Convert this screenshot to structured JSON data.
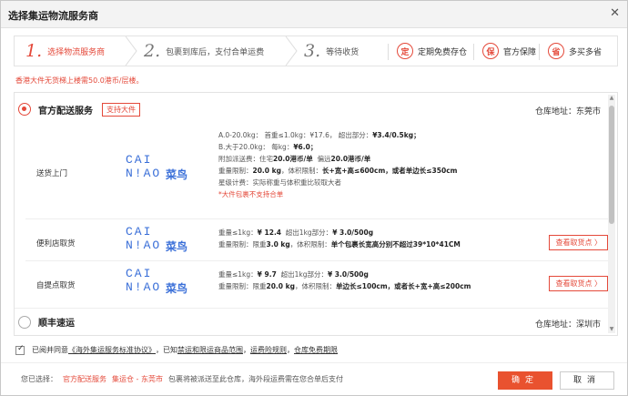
{
  "dialog": {
    "title": "选择集运物流服务商",
    "close_icon": "close-icon"
  },
  "steps": [
    {
      "num": "1.",
      "label": "选择物流服务商"
    },
    {
      "num": "2.",
      "label": "包裹到库后，支付合单运费"
    },
    {
      "num": "3.",
      "label": "等待收货"
    }
  ],
  "features": [
    {
      "icon_char": "定",
      "label": "定期免费存仓"
    },
    {
      "icon_char": "保",
      "label": "官方保障"
    },
    {
      "icon_char": "省",
      "label": "多买多省"
    }
  ],
  "notice": "香港大件无货梯上楼需50.0港币/层楼。",
  "providers": [
    {
      "name": "官方配送服务",
      "tag": "支持大件",
      "warehouse": "仓库地址：东莞市",
      "methods": [
        {
          "name": "送货上门",
          "logo_cai": "CAI",
          "logo_niao": "N!AO",
          "logo_cn": "菜鸟",
          "lines": [
            "A.0-20.0kg：         首重≤1.0kg：¥17.6， 超出部分：",
            "B.大于20.0kg：       每kg：",
            "附加派送费：住宅",
            "重量限制：",
            "星级计费：实际称重与体积重比较取大者",
            "*大件包裹不支持合单"
          ],
          "a_price": "¥3.4/0.5kg；",
          "b_price": "¥6.0；",
          "extra_res": "20.0港币/单",
          "extra_remote_label": "偏远",
          "extra_remote": "20.0港币/单",
          "weight_limit": "20.0 kg",
          "vol_label": "，体积限制：",
          "vol_limit": "长+宽+高≤600cm，或者单边长≤350cm"
        },
        {
          "name": "便利店取货",
          "logo_cai": "CAI",
          "logo_niao": "N!AO",
          "logo_cn": "菜鸟",
          "line1_pre": "重量≤1kg：",
          "line1_price": "¥ 12.4",
          "line1_mid": "超出1kg部分：",
          "line1_extra": "¥ 3.0/500g",
          "line2_pre": "重量限制：限重",
          "line2_weight": "3.0 kg",
          "line2_mid": "，体积限制：",
          "line2_vol": "单个包裹长宽高分别不超过39*10*41CM",
          "button": "查看取货点 〉"
        },
        {
          "name": "自提点取货",
          "logo_cai": "CAI",
          "logo_niao": "N!AO",
          "logo_cn": "菜鸟",
          "line1_pre": "重量≤1kg：",
          "line1_price": "¥ 9.7",
          "line1_mid": "超出1kg部分：",
          "line1_extra": "¥ 3.0/500g",
          "line2_pre": "重量限制：限重",
          "line2_weight": "20.0 kg",
          "line2_mid": "，体积限制：",
          "line2_vol": "单边长≤100cm，或者长+宽+高≤200cm",
          "button": "查看取货点 〉"
        }
      ]
    },
    {
      "name": "顺丰速运",
      "warehouse": "仓库地址：深圳市"
    }
  ],
  "agreement": {
    "pre": "已阅并同意",
    "link1": "《海外集运服务标准协议》",
    "mid1": "，已知",
    "link2": "禁运和限运商品范围",
    "mid2": "，",
    "link3": "运费险规则",
    "mid3": "，",
    "link4": "仓库免费期限"
  },
  "footer": {
    "label": "您已选择：",
    "provider": "官方配送服务",
    "route": "集运仓 - 东莞市",
    "desc": "包裹将被派送至此仓库，海外段运费需在您合单后支付",
    "ok": "确定",
    "cancel": "取消"
  }
}
